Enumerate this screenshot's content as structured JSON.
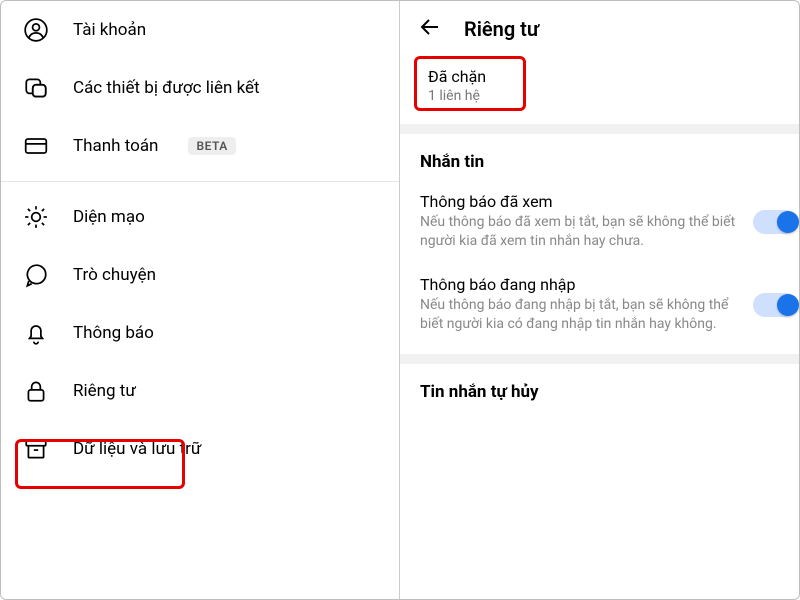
{
  "left": {
    "items": [
      {
        "label": "Tài khoản"
      },
      {
        "label": "Các thiết bị được liên kết"
      },
      {
        "label": "Thanh toán",
        "badge": "BETA"
      },
      {
        "label": "Diện mạo"
      },
      {
        "label": "Trò chuyện"
      },
      {
        "label": "Thông báo"
      },
      {
        "label": "Riêng tư"
      },
      {
        "label": "Dữ liệu và lưu trữ"
      }
    ]
  },
  "right": {
    "title": "Riêng tư",
    "blocked": {
      "title": "Đã chặn",
      "sub": "1 liên hệ"
    },
    "messaging_header": "Nhắn tin",
    "settings": [
      {
        "title": "Thông báo đã xem",
        "desc": "Nếu thông báo đã xem bị tắt, bạn sẽ không thể biết người kia đã xem tin nhắn hay chưa.",
        "on": true
      },
      {
        "title": "Thông báo đang nhập",
        "desc": "Nếu thông báo đang nhập bị tắt, bạn sẽ không thể biết người kia có đang nhập tin nhắn hay không.",
        "on": true
      }
    ],
    "disappearing_header": "Tin nhắn tự hủy"
  }
}
